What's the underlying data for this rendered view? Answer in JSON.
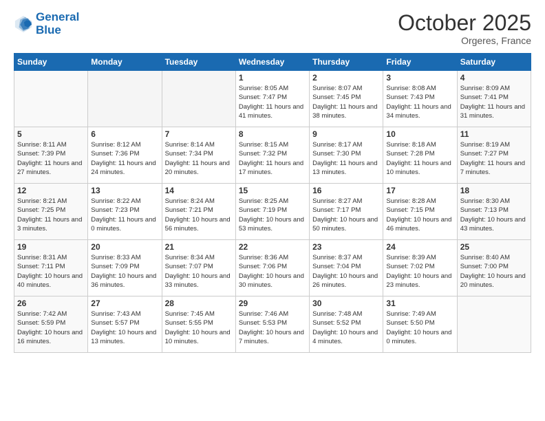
{
  "header": {
    "logo_line1": "General",
    "logo_line2": "Blue",
    "month": "October 2025",
    "location": "Orgeres, France"
  },
  "weekdays": [
    "Sunday",
    "Monday",
    "Tuesday",
    "Wednesday",
    "Thursday",
    "Friday",
    "Saturday"
  ],
  "weeks": [
    [
      {
        "day": "",
        "sunrise": "",
        "sunset": "",
        "daylight": ""
      },
      {
        "day": "",
        "sunrise": "",
        "sunset": "",
        "daylight": ""
      },
      {
        "day": "",
        "sunrise": "",
        "sunset": "",
        "daylight": ""
      },
      {
        "day": "1",
        "sunrise": "Sunrise: 8:05 AM",
        "sunset": "Sunset: 7:47 PM",
        "daylight": "Daylight: 11 hours and 41 minutes."
      },
      {
        "day": "2",
        "sunrise": "Sunrise: 8:07 AM",
        "sunset": "Sunset: 7:45 PM",
        "daylight": "Daylight: 11 hours and 38 minutes."
      },
      {
        "day": "3",
        "sunrise": "Sunrise: 8:08 AM",
        "sunset": "Sunset: 7:43 PM",
        "daylight": "Daylight: 11 hours and 34 minutes."
      },
      {
        "day": "4",
        "sunrise": "Sunrise: 8:09 AM",
        "sunset": "Sunset: 7:41 PM",
        "daylight": "Daylight: 11 hours and 31 minutes."
      }
    ],
    [
      {
        "day": "5",
        "sunrise": "Sunrise: 8:11 AM",
        "sunset": "Sunset: 7:39 PM",
        "daylight": "Daylight: 11 hours and 27 minutes."
      },
      {
        "day": "6",
        "sunrise": "Sunrise: 8:12 AM",
        "sunset": "Sunset: 7:36 PM",
        "daylight": "Daylight: 11 hours and 24 minutes."
      },
      {
        "day": "7",
        "sunrise": "Sunrise: 8:14 AM",
        "sunset": "Sunset: 7:34 PM",
        "daylight": "Daylight: 11 hours and 20 minutes."
      },
      {
        "day": "8",
        "sunrise": "Sunrise: 8:15 AM",
        "sunset": "Sunset: 7:32 PM",
        "daylight": "Daylight: 11 hours and 17 minutes."
      },
      {
        "day": "9",
        "sunrise": "Sunrise: 8:17 AM",
        "sunset": "Sunset: 7:30 PM",
        "daylight": "Daylight: 11 hours and 13 minutes."
      },
      {
        "day": "10",
        "sunrise": "Sunrise: 8:18 AM",
        "sunset": "Sunset: 7:28 PM",
        "daylight": "Daylight: 11 hours and 10 minutes."
      },
      {
        "day": "11",
        "sunrise": "Sunrise: 8:19 AM",
        "sunset": "Sunset: 7:27 PM",
        "daylight": "Daylight: 11 hours and 7 minutes."
      }
    ],
    [
      {
        "day": "12",
        "sunrise": "Sunrise: 8:21 AM",
        "sunset": "Sunset: 7:25 PM",
        "daylight": "Daylight: 11 hours and 3 minutes."
      },
      {
        "day": "13",
        "sunrise": "Sunrise: 8:22 AM",
        "sunset": "Sunset: 7:23 PM",
        "daylight": "Daylight: 11 hours and 0 minutes."
      },
      {
        "day": "14",
        "sunrise": "Sunrise: 8:24 AM",
        "sunset": "Sunset: 7:21 PM",
        "daylight": "Daylight: 10 hours and 56 minutes."
      },
      {
        "day": "15",
        "sunrise": "Sunrise: 8:25 AM",
        "sunset": "Sunset: 7:19 PM",
        "daylight": "Daylight: 10 hours and 53 minutes."
      },
      {
        "day": "16",
        "sunrise": "Sunrise: 8:27 AM",
        "sunset": "Sunset: 7:17 PM",
        "daylight": "Daylight: 10 hours and 50 minutes."
      },
      {
        "day": "17",
        "sunrise": "Sunrise: 8:28 AM",
        "sunset": "Sunset: 7:15 PM",
        "daylight": "Daylight: 10 hours and 46 minutes."
      },
      {
        "day": "18",
        "sunrise": "Sunrise: 8:30 AM",
        "sunset": "Sunset: 7:13 PM",
        "daylight": "Daylight: 10 hours and 43 minutes."
      }
    ],
    [
      {
        "day": "19",
        "sunrise": "Sunrise: 8:31 AM",
        "sunset": "Sunset: 7:11 PM",
        "daylight": "Daylight: 10 hours and 40 minutes."
      },
      {
        "day": "20",
        "sunrise": "Sunrise: 8:33 AM",
        "sunset": "Sunset: 7:09 PM",
        "daylight": "Daylight: 10 hours and 36 minutes."
      },
      {
        "day": "21",
        "sunrise": "Sunrise: 8:34 AM",
        "sunset": "Sunset: 7:07 PM",
        "daylight": "Daylight: 10 hours and 33 minutes."
      },
      {
        "day": "22",
        "sunrise": "Sunrise: 8:36 AM",
        "sunset": "Sunset: 7:06 PM",
        "daylight": "Daylight: 10 hours and 30 minutes."
      },
      {
        "day": "23",
        "sunrise": "Sunrise: 8:37 AM",
        "sunset": "Sunset: 7:04 PM",
        "daylight": "Daylight: 10 hours and 26 minutes."
      },
      {
        "day": "24",
        "sunrise": "Sunrise: 8:39 AM",
        "sunset": "Sunset: 7:02 PM",
        "daylight": "Daylight: 10 hours and 23 minutes."
      },
      {
        "day": "25",
        "sunrise": "Sunrise: 8:40 AM",
        "sunset": "Sunset: 7:00 PM",
        "daylight": "Daylight: 10 hours and 20 minutes."
      }
    ],
    [
      {
        "day": "26",
        "sunrise": "Sunrise: 7:42 AM",
        "sunset": "Sunset: 5:59 PM",
        "daylight": "Daylight: 10 hours and 16 minutes."
      },
      {
        "day": "27",
        "sunrise": "Sunrise: 7:43 AM",
        "sunset": "Sunset: 5:57 PM",
        "daylight": "Daylight: 10 hours and 13 minutes."
      },
      {
        "day": "28",
        "sunrise": "Sunrise: 7:45 AM",
        "sunset": "Sunset: 5:55 PM",
        "daylight": "Daylight: 10 hours and 10 minutes."
      },
      {
        "day": "29",
        "sunrise": "Sunrise: 7:46 AM",
        "sunset": "Sunset: 5:53 PM",
        "daylight": "Daylight: 10 hours and 7 minutes."
      },
      {
        "day": "30",
        "sunrise": "Sunrise: 7:48 AM",
        "sunset": "Sunset: 5:52 PM",
        "daylight": "Daylight: 10 hours and 4 minutes."
      },
      {
        "day": "31",
        "sunrise": "Sunrise: 7:49 AM",
        "sunset": "Sunset: 5:50 PM",
        "daylight": "Daylight: 10 hours and 0 minutes."
      },
      {
        "day": "",
        "sunrise": "",
        "sunset": "",
        "daylight": ""
      }
    ]
  ]
}
